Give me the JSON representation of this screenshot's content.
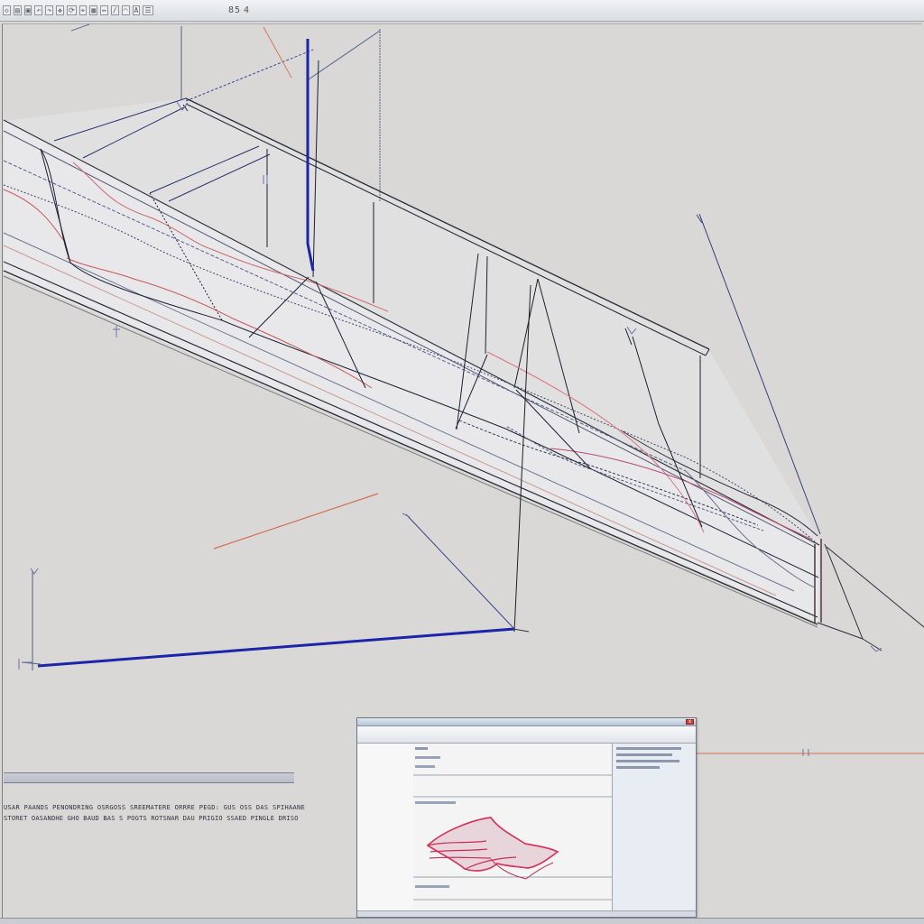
{
  "toolbar": {
    "zoom_text": "85",
    "view_text": "4"
  },
  "command_area": {
    "line1": "USAR PAANDS PENONDRING OSRGOSS SREEMATERE ORRRE PEGD: GUS OSS DAS SPIHAANE",
    "line2": "STORET OASANDHE GHO BAUD BAS S POGTS ROTSNAR DAU PRIGIO SSAED PINGLE DRISO"
  },
  "popup": {
    "close_label": "x"
  },
  "colors": {
    "background": "#d9d8d6",
    "construction_line": "#1c25a8",
    "reference_line": "#d46e55",
    "model_edge": "#2a2d3a",
    "preview_shape": "#d4385f"
  }
}
